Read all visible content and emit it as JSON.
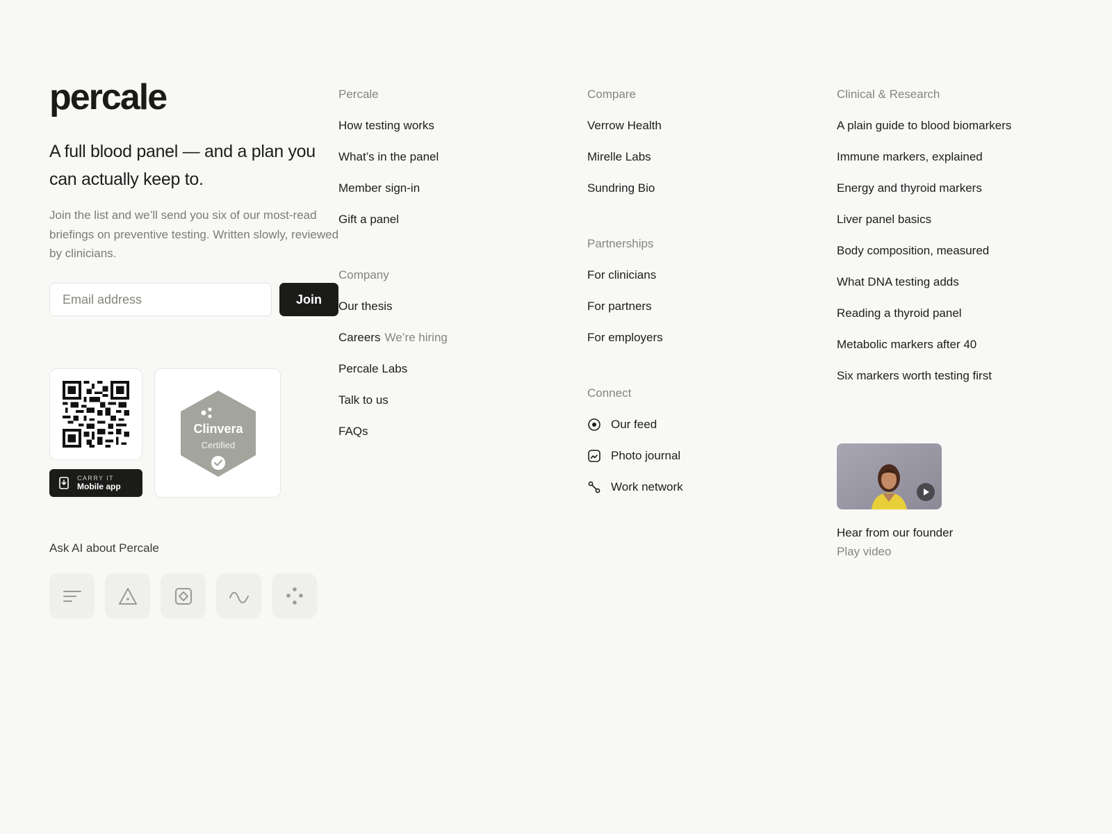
{
  "brand": {
    "logo": "percale",
    "tagline": "A full blood panel — and a plan you can actually keep to.",
    "blurb": "Join the list and we’ll send you six of our most-read briefings on preventive testing. Written slowly, reviewed by clinicians."
  },
  "signup": {
    "placeholder": "Email address",
    "button": "Join"
  },
  "app": {
    "eyebrow": "CARRY IT",
    "label": "Mobile app"
  },
  "badge": {
    "name": "Clinvera",
    "sub": "Certified"
  },
  "ask_ai": {
    "label": "Ask AI about Percale",
    "icons": [
      "lines-icon",
      "triangle-icon",
      "diamond-square-icon",
      "wave-icon",
      "dots-icon"
    ]
  },
  "columns": {
    "percale": {
      "heading": "Percale",
      "links": [
        "How testing works",
        "What’s in the panel",
        "Member sign-in",
        "Gift a panel"
      ]
    },
    "company": {
      "heading": "Company",
      "links": [
        {
          "label": "Our thesis",
          "hint": ""
        },
        {
          "label": "Careers",
          "hint": "We’re hiring"
        },
        {
          "label": "Percale Labs",
          "hint": ""
        },
        {
          "label": "Talk to us",
          "hint": ""
        },
        {
          "label": "FAQs",
          "hint": ""
        }
      ]
    },
    "compare": {
      "heading": "Compare",
      "links": [
        "Verrow Health",
        "Mirelle Labs",
        "Sundring Bio"
      ]
    },
    "partnerships": {
      "heading": "Partnerships",
      "links": [
        "For clinicians",
        "For partners",
        "For employers"
      ]
    },
    "connect": {
      "heading": "Connect",
      "links": [
        {
          "label": "Our feed",
          "icon": "feed-icon"
        },
        {
          "label": "Photo journal",
          "icon": "photo-icon"
        },
        {
          "label": "Work network",
          "icon": "network-icon"
        }
      ]
    },
    "clinical": {
      "heading": "Clinical & Research",
      "links": [
        "A plain guide to blood biomarkers",
        "Immune markers, explained",
        "Energy and thyroid markers",
        "Liver panel basics",
        "Body composition, measured",
        "What DNA testing adds",
        "Reading a thyroid panel",
        "Metabolic markers after 40",
        "Six markers worth testing first"
      ]
    }
  },
  "video": {
    "title": "Hear from our founder",
    "sub": "Play video"
  },
  "colors": {
    "background": "#f8f8f6",
    "ink": "#1b1b19",
    "muted": "#85857f",
    "badge": "#a3a59c"
  }
}
